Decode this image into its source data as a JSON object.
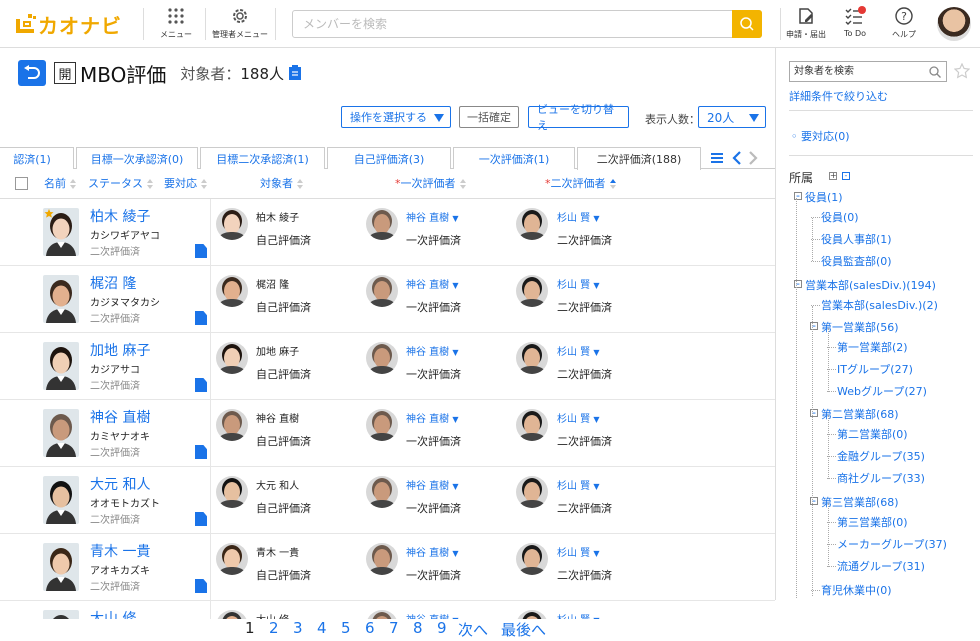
{
  "app": {
    "logo_text": "カオナビ",
    "brand_color": "#f0a800",
    "accent_color": "#1a73e8"
  },
  "header": {
    "menu_label": "メニュー",
    "admin_menu_label": "管理者メニュー",
    "search_placeholder": "メンバーを検索",
    "apply_label": "申請・届出",
    "todo_label": "To Do",
    "help_label": "ヘルプ"
  },
  "page": {
    "title": "MBO評価",
    "open_label": "開",
    "target_count_label": "対象者：",
    "target_count": "188人"
  },
  "toolbar": {
    "action_select": "操作を選択する",
    "bulk_confirm": "一括確定",
    "switch_view": "ビューを切り替え",
    "display_count_label": "表示人数：",
    "display_count": "20人"
  },
  "tabs": [
    {
      "label": "認済(1)"
    },
    {
      "label": "目標一次承認済(0)"
    },
    {
      "label": "目標二次承認済(1)"
    },
    {
      "label": "自己評価済(3)"
    },
    {
      "label": "一次評価済(1)"
    },
    {
      "label": "二次評価済(188)"
    }
  ],
  "columns": {
    "name": "名前",
    "status": "ステータス",
    "action_needed": "要対応",
    "target": "対象者",
    "first_evaluator": "一次評価者",
    "second_evaluator": "二次評価者",
    "required_mark": "*"
  },
  "rows": [
    {
      "name": "柏木 綾子",
      "kana": "カシワギアヤコ",
      "status": "二次評価済",
      "target_name": "柏木 綾子",
      "target_status": "自己評価済",
      "first_name": "神谷 直樹",
      "first_status": "一次評価済",
      "second_name": "杉山 賢",
      "second_status": "二次評価済"
    },
    {
      "name": "梶沼 隆",
      "kana": "カジヌマタカシ",
      "status": "二次評価済",
      "target_name": "梶沼 隆",
      "target_status": "自己評価済",
      "first_name": "神谷 直樹",
      "first_status": "一次評価済",
      "second_name": "杉山 賢",
      "second_status": "二次評価済"
    },
    {
      "name": "加地 麻子",
      "kana": "カジアサコ",
      "status": "二次評価済",
      "target_name": "加地 麻子",
      "target_status": "自己評価済",
      "first_name": "神谷 直樹",
      "first_status": "一次評価済",
      "second_name": "杉山 賢",
      "second_status": "二次評価済"
    },
    {
      "name": "神谷 直樹",
      "kana": "カミヤナオキ",
      "status": "二次評価済",
      "target_name": "神谷 直樹",
      "target_status": "自己評価済",
      "first_name": "神谷 直樹",
      "first_status": "一次評価済",
      "second_name": "杉山 賢",
      "second_status": "二次評価済"
    },
    {
      "name": "大元 和人",
      "kana": "オオモトカズト",
      "status": "二次評価済",
      "target_name": "大元 和人",
      "target_status": "自己評価済",
      "first_name": "神谷 直樹",
      "first_status": "一次評価済",
      "second_name": "杉山 賢",
      "second_status": "二次評価済"
    },
    {
      "name": "青木 一貴",
      "kana": "アオキカズキ",
      "status": "二次評価済",
      "target_name": "青木 一貴",
      "target_status": "自己評価済",
      "first_name": "神谷 直樹",
      "first_status": "一次評価済",
      "second_name": "杉山 賢",
      "second_status": "二次評価済"
    },
    {
      "name": "大山 修",
      "kana": "",
      "status": "",
      "target_name": "大山 修",
      "target_status": "",
      "first_name": "神谷 直樹",
      "first_status": "",
      "second_name": "杉山 賢",
      "second_status": ""
    }
  ],
  "pagination": {
    "pages": [
      "1",
      "2",
      "3",
      "4",
      "5",
      "6",
      "7",
      "8",
      "9"
    ],
    "current": "1",
    "next": "次へ",
    "last": "最後へ"
  },
  "sidebar": {
    "search_placeholder": "対象者を検索",
    "advanced": "詳細条件で絞り込む",
    "action_needed": "要対応(0)",
    "dept_label": "所属",
    "tree": [
      "役員(1)",
      "役員(0)",
      "役員人事部(1)",
      "役員監査部(0)",
      "営業本部(salesDiv.)(194)",
      "営業本部(salesDiv.)(2)",
      "第一営業部(56)",
      "第一営業部(2)",
      "ITグループ(27)",
      "Webグループ(27)",
      "第二営業部(68)",
      "第二営業部(0)",
      "金融グループ(35)",
      "商社グループ(33)",
      "第三営業部(68)",
      "第三営業部(0)",
      "メーカーグループ(37)",
      "流通グループ(31)",
      "育児休業中(0)"
    ]
  }
}
